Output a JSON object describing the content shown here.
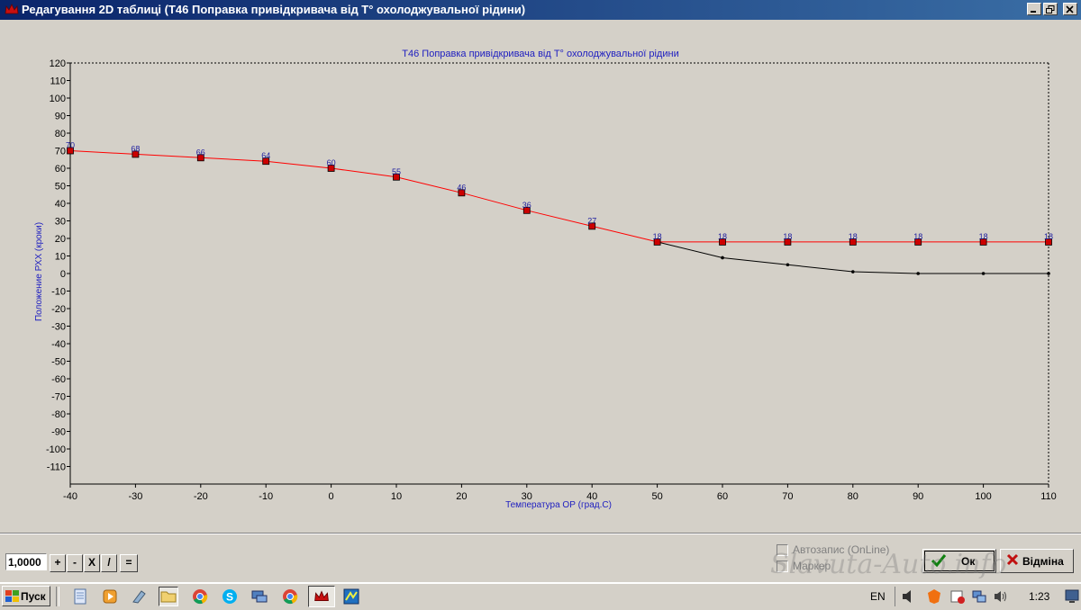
{
  "window": {
    "title": "Редагування 2D таблиці (T46 Поправка привідкривача від T° охолоджувальної рідини)",
    "controls": [
      "minimize",
      "restore",
      "close"
    ]
  },
  "chart_data": {
    "type": "line",
    "title": "T46 Поправка привідкривача від T° охолоджувальної рідини",
    "xlabel": "Температура ОР (град.С)",
    "ylabel": "Положение РХХ (кроки)",
    "x": [
      -40,
      -30,
      -20,
      -10,
      0,
      10,
      20,
      30,
      40,
      50,
      60,
      70,
      80,
      90,
      100,
      110
    ],
    "xlim": [
      -40,
      110
    ],
    "ylim": [
      -120,
      120
    ],
    "yticks": [
      120,
      110,
      100,
      90,
      80,
      70,
      60,
      50,
      40,
      30,
      20,
      10,
      0,
      -10,
      -20,
      -30,
      -40,
      -50,
      -60,
      -70,
      -80,
      -90,
      -100,
      -110
    ],
    "series": [
      {
        "values": [
          70,
          68,
          66,
          64,
          60,
          55,
          46,
          36,
          27,
          18,
          18,
          18,
          18,
          18,
          18,
          18
        ],
        "color": "#ff0000",
        "marker_color": "#cc0000",
        "labels_shown": true
      },
      {
        "x": [
          50,
          60,
          70,
          80,
          90,
          100,
          110
        ],
        "values": [
          18,
          9,
          5,
          1,
          0,
          0,
          0
        ],
        "color": "#000000"
      }
    ],
    "grid": false,
    "title_color": "#2020c0",
    "label_color": "#2020c0"
  },
  "controls": {
    "multiplier_value": "1,0000",
    "op_buttons": [
      "+",
      "-",
      "X",
      "/",
      "="
    ],
    "autosave_label": "Автозапис (OnLine)",
    "marker_label": "Маркер",
    "ok_label": "Ок",
    "cancel_label": "Відміна"
  },
  "watermark": "Slavuta-Auto.info",
  "taskbar": {
    "start_label": "Пуск",
    "apps": [
      "notepad-icon",
      "media-player-icon",
      "paint-icon",
      "folder-icon",
      "chrome-icon",
      "skype-icon",
      "network-icon",
      "chrome-icon",
      "crown-app-icon",
      "map-app-icon"
    ],
    "language": "EN",
    "tray_icons": [
      "speaker-icon",
      "antivirus-icon",
      "security-icon",
      "network-tray-icon",
      "volume-icon"
    ],
    "clock": "1:23"
  }
}
